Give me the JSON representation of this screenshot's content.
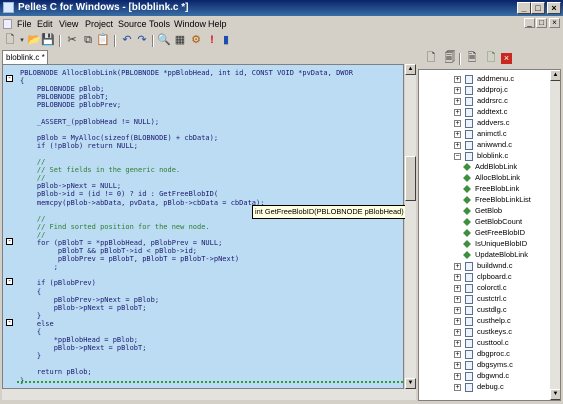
{
  "window": {
    "title": "Pelles C for Windows - [bloblink.c *]",
    "controls": {
      "minimize": "_",
      "maximize": "□",
      "close": "×"
    }
  },
  "menu": [
    "File",
    "Edit",
    "View",
    "Project",
    "Source",
    "Tools",
    "Window",
    "Help"
  ],
  "editor": {
    "tab_label": "bloblink.c *",
    "tooltip": "int GetFreeBlobID(PBLOBNODE pBlobHead)",
    "lines": [
      "PBLOBNODE AllocBlobLink(PBLOBNODE *ppBlobHead, int id, CONST VOID *pvData, DWOR",
      "{",
      "    PBLOBNODE pBlob;",
      "    PBLOBNODE pBlobT;",
      "    PBLOBNODE pBlobPrev;",
      "",
      "    _ASSERT_(ppBlobHead != NULL);",
      "",
      "    pBlob = MyAlloc(sizeof(BLOBNODE) + cbData);",
      "    if (!pBlob) return NULL;",
      "",
      "    //",
      "    // Set fields in the generic node.",
      "    //",
      "    pBlob->pNext = NULL;",
      "    pBlob->id = (id != 0) ? id : GetFreeBlobID(",
      "    memcpy(pBlob->abData, pvData, pBlob->cbData = cbData);",
      "",
      "    //",
      "    // Find sorted position for the new node.",
      "    //",
      "    for (pBlobT = *ppBlobHead, pBlobPrev = NULL;",
      "         pBlobT && pBlobT->id < pBlob->id;",
      "         pBlobPrev = pBlobT, pBlobT = pBlobT->pNext)",
      "        ;",
      "",
      "    if (pBlobPrev)",
      "    {",
      "        pBlobPrev->pNext = pBlob;",
      "        pBlob->pNext = pBlobT;",
      "    }",
      "    else",
      "    {",
      "        *ppBlobHead = pBlob;",
      "        pBlob->pNext = pBlobT;",
      "    }",
      "",
      "    return pBlob;",
      "}"
    ]
  },
  "tree": [
    {
      "label": "addmenu.c",
      "kind": "file"
    },
    {
      "label": "addproj.c",
      "kind": "file"
    },
    {
      "label": "addrsrc.c",
      "kind": "file"
    },
    {
      "label": "addtext.c",
      "kind": "file"
    },
    {
      "label": "addvers.c",
      "kind": "file"
    },
    {
      "label": "animctl.c",
      "kind": "file"
    },
    {
      "label": "aniwwnd.c",
      "kind": "file"
    },
    {
      "label": "bloblink.c",
      "kind": "file",
      "expanded": true
    },
    {
      "label": "AddBlobLink",
      "kind": "func"
    },
    {
      "label": "AllocBlobLink",
      "kind": "func"
    },
    {
      "label": "FreeBlobLink",
      "kind": "func"
    },
    {
      "label": "FreeBlobLinkList",
      "kind": "func"
    },
    {
      "label": "GetBlob",
      "kind": "func"
    },
    {
      "label": "GetBlobCount",
      "kind": "func"
    },
    {
      "label": "GetFreeBlobID",
      "kind": "func"
    },
    {
      "label": "IsUniqueBlobID",
      "kind": "func"
    },
    {
      "label": "UpdateBlobLink",
      "kind": "func"
    },
    {
      "label": "buildwnd.c",
      "kind": "file"
    },
    {
      "label": "clpboard.c",
      "kind": "file"
    },
    {
      "label": "colorctl.c",
      "kind": "file"
    },
    {
      "label": "custctrl.c",
      "kind": "file"
    },
    {
      "label": "custdlg.c",
      "kind": "file"
    },
    {
      "label": "custhelp.c",
      "kind": "file"
    },
    {
      "label": "custkeys.c",
      "kind": "file"
    },
    {
      "label": "custtool.c",
      "kind": "file"
    },
    {
      "label": "dbgproc.c",
      "kind": "file"
    },
    {
      "label": "dbgsyms.c",
      "kind": "file"
    },
    {
      "label": "dbgwnd.c",
      "kind": "file"
    },
    {
      "label": "debug.c",
      "kind": "file"
    }
  ],
  "icons": {
    "toolbar": [
      "new-file-icon",
      "dropdown-icon",
      "open-folder-icon",
      "save-icon",
      "cut-icon",
      "copy-icon",
      "paste-icon",
      "undo-icon",
      "redo-icon",
      "find-icon",
      "build-icon",
      "execute-icon",
      "stop-icon",
      "help-icon"
    ],
    "panel_toolbar": [
      "document-icon",
      "document-list-icon",
      "add-document-icon",
      "close-red-icon"
    ]
  },
  "colors": {
    "editor_bg": "#bcdcf4",
    "title_bar": "#0a246a",
    "tooltip_bg": "#ffffe1"
  }
}
